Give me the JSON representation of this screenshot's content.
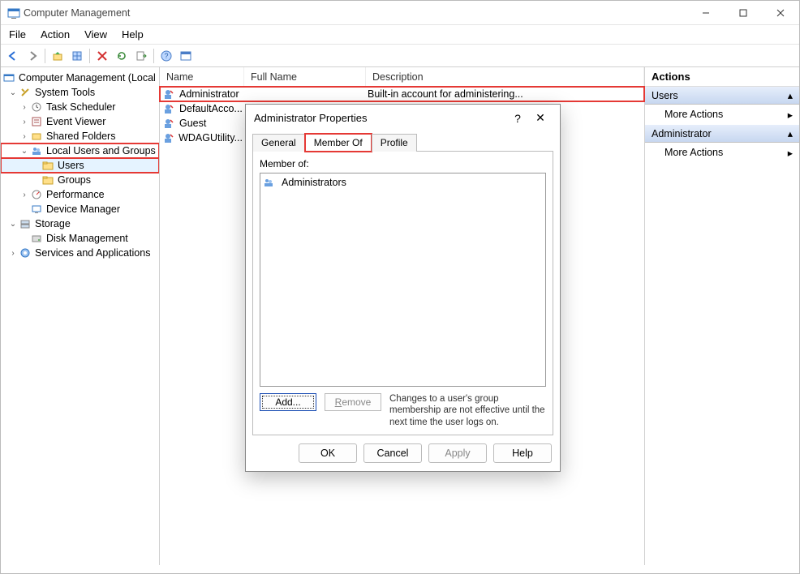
{
  "window": {
    "title": "Computer Management"
  },
  "menu": {
    "file": "File",
    "action": "Action",
    "view": "View",
    "help": "Help"
  },
  "tree": {
    "root": "Computer Management (Local",
    "systools": "System Tools",
    "tasksched": "Task Scheduler",
    "eventvwr": "Event Viewer",
    "shared": "Shared Folders",
    "lusrmgr": "Local Users and Groups",
    "users": "Users",
    "groups": "Groups",
    "perf": "Performance",
    "devmgr": "Device Manager",
    "storage": "Storage",
    "diskmgmt": "Disk Management",
    "services": "Services and Applications"
  },
  "list": {
    "headers": {
      "name": "Name",
      "fullname": "Full Name",
      "desc": "Description"
    },
    "rows": [
      {
        "name": "Administrator",
        "full": "",
        "desc": "Built-in account for administering..."
      },
      {
        "name": "DefaultAcco...",
        "full": "",
        "desc": ""
      },
      {
        "name": "Guest",
        "full": "",
        "desc": ""
      },
      {
        "name": "WDAGUtility...",
        "full": "",
        "desc": ""
      }
    ]
  },
  "actions": {
    "header": "Actions",
    "g1": "Users",
    "more": "More Actions",
    "g2": "Administrator"
  },
  "dialog": {
    "title": "Administrator Properties",
    "tabs": {
      "general": "General",
      "memberof": "Member Of",
      "profile": "Profile"
    },
    "memberof_label": "Member of:",
    "members": [
      "Administrators"
    ],
    "add": "Add...",
    "remove": "Remove",
    "note": "Changes to a user's group membership are not effective until the next time the user logs on.",
    "ok": "OK",
    "cancel": "Cancel",
    "apply": "Apply",
    "help": "Help"
  }
}
